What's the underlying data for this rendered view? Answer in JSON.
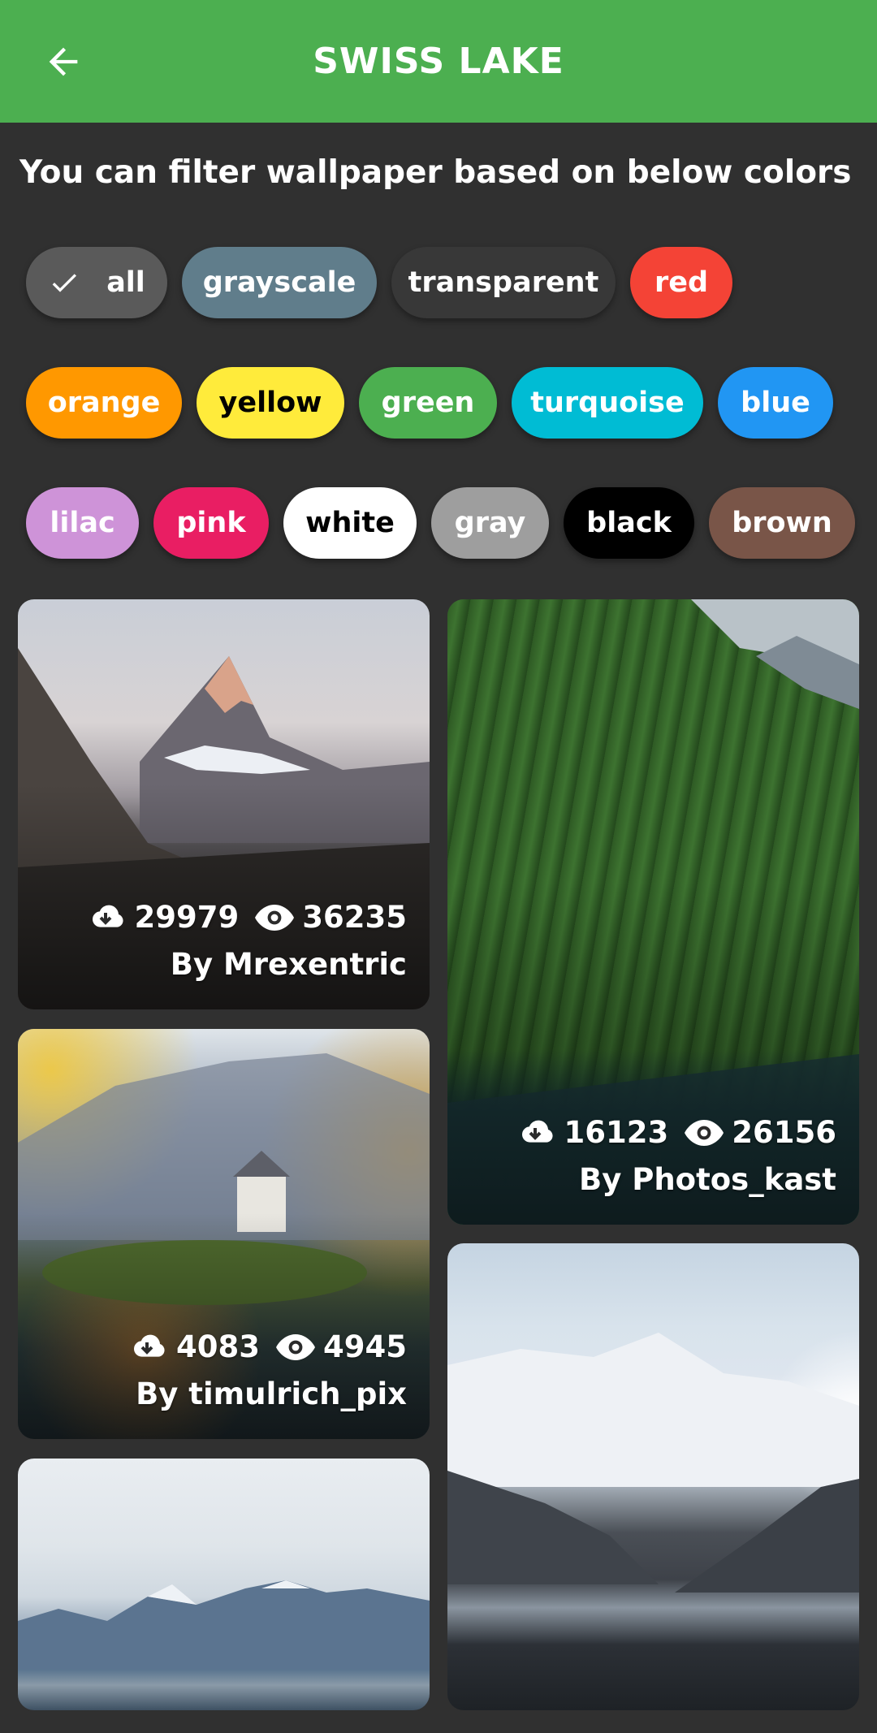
{
  "appbar": {
    "title": "SWISS LAKE",
    "back_icon": "arrow-left-icon",
    "background": "#4caf50"
  },
  "filter_prompt": "You can filter wallpaper based on below colors",
  "chips": {
    "row1": [
      {
        "label": "all",
        "color": "#5a5a5a",
        "text": "#ffffff",
        "selected": true
      },
      {
        "label": "grayscale",
        "color": "#607d8b",
        "text": "#ffffff",
        "selected": false
      },
      {
        "label": "transparent",
        "color": "#383838",
        "text": "#ffffff",
        "selected": false
      },
      {
        "label": "red",
        "color": "#f44336",
        "text": "#ffffff",
        "selected": false
      }
    ],
    "row2": [
      {
        "label": "orange",
        "color": "#ff9800",
        "text": "#ffffff"
      },
      {
        "label": "yellow",
        "color": "#ffeb3b",
        "text": "#000000"
      },
      {
        "label": "green",
        "color": "#4caf50",
        "text": "#ffffff"
      },
      {
        "label": "turquoise",
        "color": "#00bcd4",
        "text": "#ffffff"
      },
      {
        "label": "blue",
        "color": "#2196f3",
        "text": "#ffffff"
      }
    ],
    "row3": [
      {
        "label": "lilac",
        "color": "#ce93d8",
        "text": "#ffffff"
      },
      {
        "label": "pink",
        "color": "#e91e63",
        "text": "#ffffff"
      },
      {
        "label": "white",
        "color": "#ffffff",
        "text": "#000000"
      },
      {
        "label": "gray",
        "color": "#9e9e9e",
        "text": "#ffffff"
      },
      {
        "label": "black",
        "color": "#000000",
        "text": "#ffffff"
      },
      {
        "label": "brown",
        "color": "#795548",
        "text": "#ffffff"
      }
    ]
  },
  "wallpapers": [
    {
      "downloads": "29979",
      "views": "36235",
      "author": "By Mrexentric"
    },
    {
      "downloads": "16123",
      "views": "26156",
      "author": "By Photos_kast"
    },
    {
      "downloads": "4083",
      "views": "4945",
      "author": "By timulrich_pix"
    },
    {
      "downloads": "",
      "views": "",
      "author": ""
    },
    {
      "downloads": "",
      "views": "",
      "author": ""
    }
  ],
  "icons": {
    "download": "cloud-download-icon",
    "views": "eye-icon",
    "check": "check-icon"
  }
}
